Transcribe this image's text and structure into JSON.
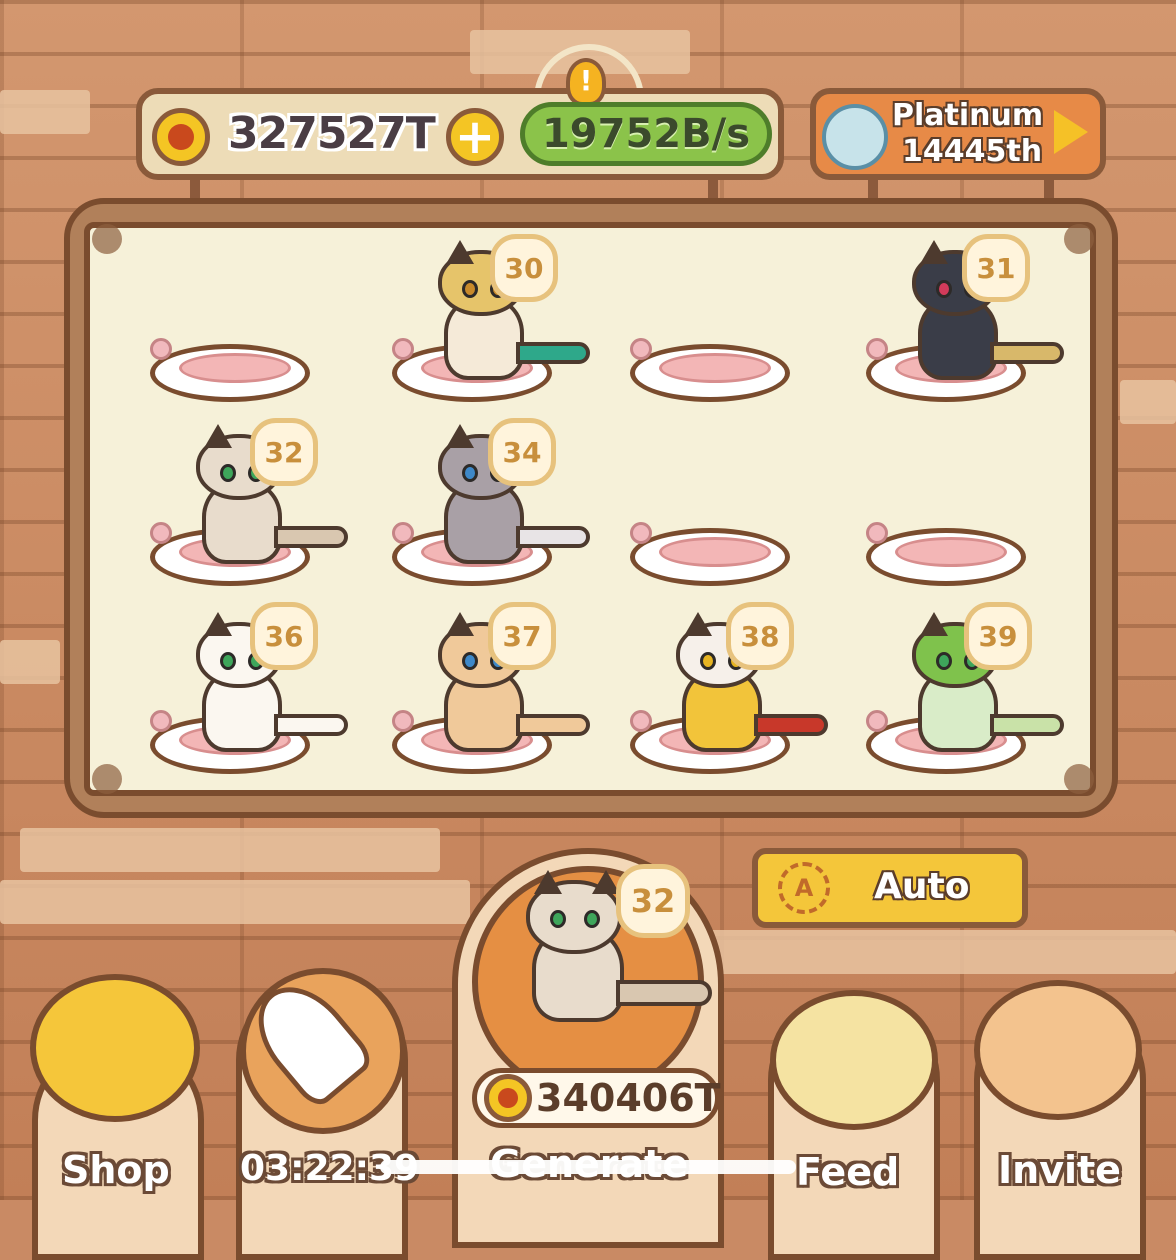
{
  "header": {
    "coins": "327527T",
    "rate": "19752B/s",
    "rank_tier": "Platinum",
    "rank_position": "14445th"
  },
  "board": {
    "slots": [
      {
        "level": ""
      },
      {
        "level": "30"
      },
      {
        "level": ""
      },
      {
        "level": "31"
      },
      {
        "level": "32"
      },
      {
        "level": "34"
      },
      {
        "level": ""
      },
      {
        "level": ""
      },
      {
        "level": "36"
      },
      {
        "level": "37"
      },
      {
        "level": "38"
      },
      {
        "level": "39"
      }
    ]
  },
  "generate": {
    "level": "32",
    "cost": "340406T",
    "label": "Generate"
  },
  "auto": {
    "label": "Auto",
    "icon": "A"
  },
  "nav": {
    "shop": "Shop",
    "boost_timer": "03:22:39",
    "feed": "Feed",
    "invite": "Invite"
  },
  "colors": {
    "accent": "#f4c524",
    "rate_green": "#8bc34a",
    "rank_orange": "#e78a47",
    "frame_brown": "#7a4c2e"
  }
}
